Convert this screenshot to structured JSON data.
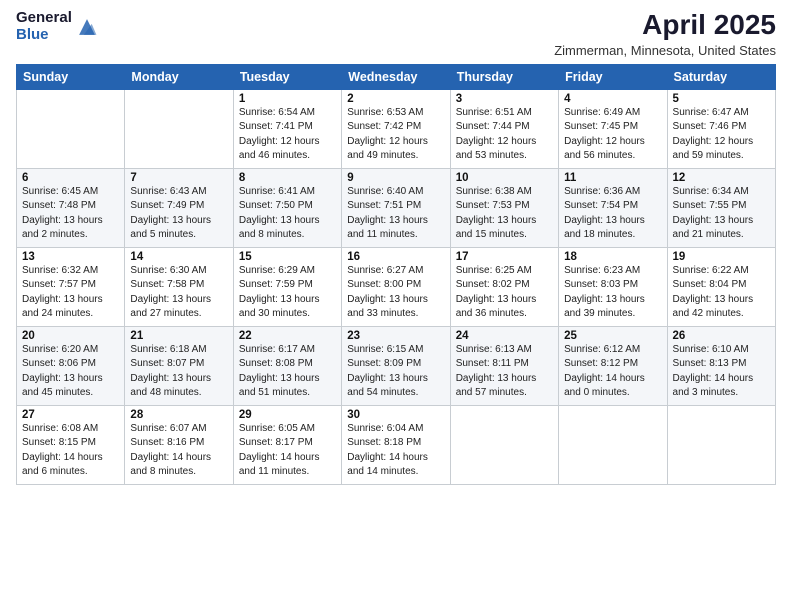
{
  "header": {
    "logo_general": "General",
    "logo_blue": "Blue",
    "title": "April 2025",
    "location": "Zimmerman, Minnesota, United States"
  },
  "calendar": {
    "days_of_week": [
      "Sunday",
      "Monday",
      "Tuesday",
      "Wednesday",
      "Thursday",
      "Friday",
      "Saturday"
    ],
    "weeks": [
      [
        {
          "day": "",
          "info": ""
        },
        {
          "day": "",
          "info": ""
        },
        {
          "day": "1",
          "info": "Sunrise: 6:54 AM\nSunset: 7:41 PM\nDaylight: 12 hours\nand 46 minutes."
        },
        {
          "day": "2",
          "info": "Sunrise: 6:53 AM\nSunset: 7:42 PM\nDaylight: 12 hours\nand 49 minutes."
        },
        {
          "day": "3",
          "info": "Sunrise: 6:51 AM\nSunset: 7:44 PM\nDaylight: 12 hours\nand 53 minutes."
        },
        {
          "day": "4",
          "info": "Sunrise: 6:49 AM\nSunset: 7:45 PM\nDaylight: 12 hours\nand 56 minutes."
        },
        {
          "day": "5",
          "info": "Sunrise: 6:47 AM\nSunset: 7:46 PM\nDaylight: 12 hours\nand 59 minutes."
        }
      ],
      [
        {
          "day": "6",
          "info": "Sunrise: 6:45 AM\nSunset: 7:48 PM\nDaylight: 13 hours\nand 2 minutes."
        },
        {
          "day": "7",
          "info": "Sunrise: 6:43 AM\nSunset: 7:49 PM\nDaylight: 13 hours\nand 5 minutes."
        },
        {
          "day": "8",
          "info": "Sunrise: 6:41 AM\nSunset: 7:50 PM\nDaylight: 13 hours\nand 8 minutes."
        },
        {
          "day": "9",
          "info": "Sunrise: 6:40 AM\nSunset: 7:51 PM\nDaylight: 13 hours\nand 11 minutes."
        },
        {
          "day": "10",
          "info": "Sunrise: 6:38 AM\nSunset: 7:53 PM\nDaylight: 13 hours\nand 15 minutes."
        },
        {
          "day": "11",
          "info": "Sunrise: 6:36 AM\nSunset: 7:54 PM\nDaylight: 13 hours\nand 18 minutes."
        },
        {
          "day": "12",
          "info": "Sunrise: 6:34 AM\nSunset: 7:55 PM\nDaylight: 13 hours\nand 21 minutes."
        }
      ],
      [
        {
          "day": "13",
          "info": "Sunrise: 6:32 AM\nSunset: 7:57 PM\nDaylight: 13 hours\nand 24 minutes."
        },
        {
          "day": "14",
          "info": "Sunrise: 6:30 AM\nSunset: 7:58 PM\nDaylight: 13 hours\nand 27 minutes."
        },
        {
          "day": "15",
          "info": "Sunrise: 6:29 AM\nSunset: 7:59 PM\nDaylight: 13 hours\nand 30 minutes."
        },
        {
          "day": "16",
          "info": "Sunrise: 6:27 AM\nSunset: 8:00 PM\nDaylight: 13 hours\nand 33 minutes."
        },
        {
          "day": "17",
          "info": "Sunrise: 6:25 AM\nSunset: 8:02 PM\nDaylight: 13 hours\nand 36 minutes."
        },
        {
          "day": "18",
          "info": "Sunrise: 6:23 AM\nSunset: 8:03 PM\nDaylight: 13 hours\nand 39 minutes."
        },
        {
          "day": "19",
          "info": "Sunrise: 6:22 AM\nSunset: 8:04 PM\nDaylight: 13 hours\nand 42 minutes."
        }
      ],
      [
        {
          "day": "20",
          "info": "Sunrise: 6:20 AM\nSunset: 8:06 PM\nDaylight: 13 hours\nand 45 minutes."
        },
        {
          "day": "21",
          "info": "Sunrise: 6:18 AM\nSunset: 8:07 PM\nDaylight: 13 hours\nand 48 minutes."
        },
        {
          "day": "22",
          "info": "Sunrise: 6:17 AM\nSunset: 8:08 PM\nDaylight: 13 hours\nand 51 minutes."
        },
        {
          "day": "23",
          "info": "Sunrise: 6:15 AM\nSunset: 8:09 PM\nDaylight: 13 hours\nand 54 minutes."
        },
        {
          "day": "24",
          "info": "Sunrise: 6:13 AM\nSunset: 8:11 PM\nDaylight: 13 hours\nand 57 minutes."
        },
        {
          "day": "25",
          "info": "Sunrise: 6:12 AM\nSunset: 8:12 PM\nDaylight: 14 hours\nand 0 minutes."
        },
        {
          "day": "26",
          "info": "Sunrise: 6:10 AM\nSunset: 8:13 PM\nDaylight: 14 hours\nand 3 minutes."
        }
      ],
      [
        {
          "day": "27",
          "info": "Sunrise: 6:08 AM\nSunset: 8:15 PM\nDaylight: 14 hours\nand 6 minutes."
        },
        {
          "day": "28",
          "info": "Sunrise: 6:07 AM\nSunset: 8:16 PM\nDaylight: 14 hours\nand 8 minutes."
        },
        {
          "day": "29",
          "info": "Sunrise: 6:05 AM\nSunset: 8:17 PM\nDaylight: 14 hours\nand 11 minutes."
        },
        {
          "day": "30",
          "info": "Sunrise: 6:04 AM\nSunset: 8:18 PM\nDaylight: 14 hours\nand 14 minutes."
        },
        {
          "day": "",
          "info": ""
        },
        {
          "day": "",
          "info": ""
        },
        {
          "day": "",
          "info": ""
        }
      ]
    ]
  }
}
